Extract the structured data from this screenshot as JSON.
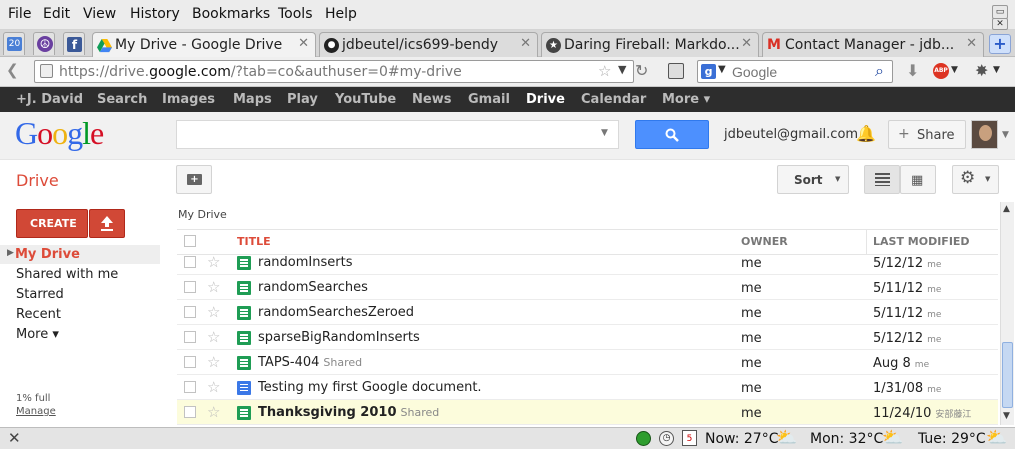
{
  "menubar": {
    "items": [
      "File",
      "Edit",
      "View",
      "History",
      "Bookmarks",
      "Tools",
      "Help"
    ]
  },
  "tabs": {
    "pinned": [
      {
        "icon": "calendar-20-icon",
        "text": "20"
      },
      {
        "icon": "peace-icon"
      },
      {
        "icon": "facebook-icon",
        "text": "f"
      }
    ],
    "items": [
      {
        "label": "My Drive - Google Drive",
        "icon": "google-drive-icon",
        "active": true
      },
      {
        "label": "jdbeutel/ics699-bendy",
        "icon": "github-icon"
      },
      {
        "label": "Daring Fireball: Markdo...",
        "icon": "star-circle-icon"
      },
      {
        "label": "Contact Manager - jdb...",
        "icon": "gmail-icon"
      }
    ],
    "new_tab": "+"
  },
  "navbar": {
    "url_prefix": "https://drive.",
    "url_domain": "google.com",
    "url_suffix": "/?tab=co&authuser=0#my-drive",
    "search_placeholder": "Google",
    "abp_label": "ABP"
  },
  "gbar": {
    "items": [
      "+J. David",
      "Search",
      "Images",
      "Maps",
      "Play",
      "YouTube",
      "News",
      "Gmail",
      "Drive",
      "Calendar",
      "More ▾"
    ],
    "active": "Drive"
  },
  "header": {
    "logo": "Google",
    "email": "jdbeutel@gmail.com",
    "share_label": "Share"
  },
  "drive": {
    "title": "Drive",
    "create_label": "CREATE",
    "sort_label": "Sort",
    "breadcrumb": "My Drive",
    "nav": [
      "My Drive",
      "Shared with me",
      "Starred",
      "Recent",
      "More ▾"
    ],
    "quota": "1% full",
    "manage": "Manage"
  },
  "table": {
    "headers": {
      "title": "TITLE",
      "owner": "OWNER",
      "modified": "LAST MODIFIED"
    },
    "rows": [
      {
        "name": "randomInserts",
        "shared": "",
        "owner": "me",
        "date": "5/12/12",
        "by": "me",
        "type": "sheet"
      },
      {
        "name": "randomSearches",
        "shared": "",
        "owner": "me",
        "date": "5/11/12",
        "by": "me",
        "type": "sheet"
      },
      {
        "name": "randomSearchesZeroed",
        "shared": "",
        "owner": "me",
        "date": "5/11/12",
        "by": "me",
        "type": "sheet"
      },
      {
        "name": "sparseBigRandomInserts",
        "shared": "",
        "owner": "me",
        "date": "5/12/12",
        "by": "me",
        "type": "sheet"
      },
      {
        "name": "TAPS-404",
        "shared": "Shared",
        "owner": "me",
        "date": "Aug 8",
        "by": "me",
        "type": "sheet"
      },
      {
        "name": "Testing my first Google document.",
        "shared": "",
        "owner": "me",
        "date": "1/31/08",
        "by": "me",
        "type": "doc"
      },
      {
        "name": "Thanksgiving 2010",
        "shared": "Shared",
        "owner": "me",
        "date": "11/24/10",
        "by": "安部藤江",
        "type": "sheet",
        "selected": true
      }
    ]
  },
  "statusbar": {
    "calendar_day": "5",
    "weather_now": "Now: 27°C",
    "weather_mon": "Mon: 32°C",
    "weather_tue": "Tue: 29°C"
  },
  "colors": {
    "drive_red": "#dd4b39",
    "gbar": "#2d2d2d",
    "blue_btn": "#4d90fe",
    "selected_row": "#fcfcdc"
  }
}
